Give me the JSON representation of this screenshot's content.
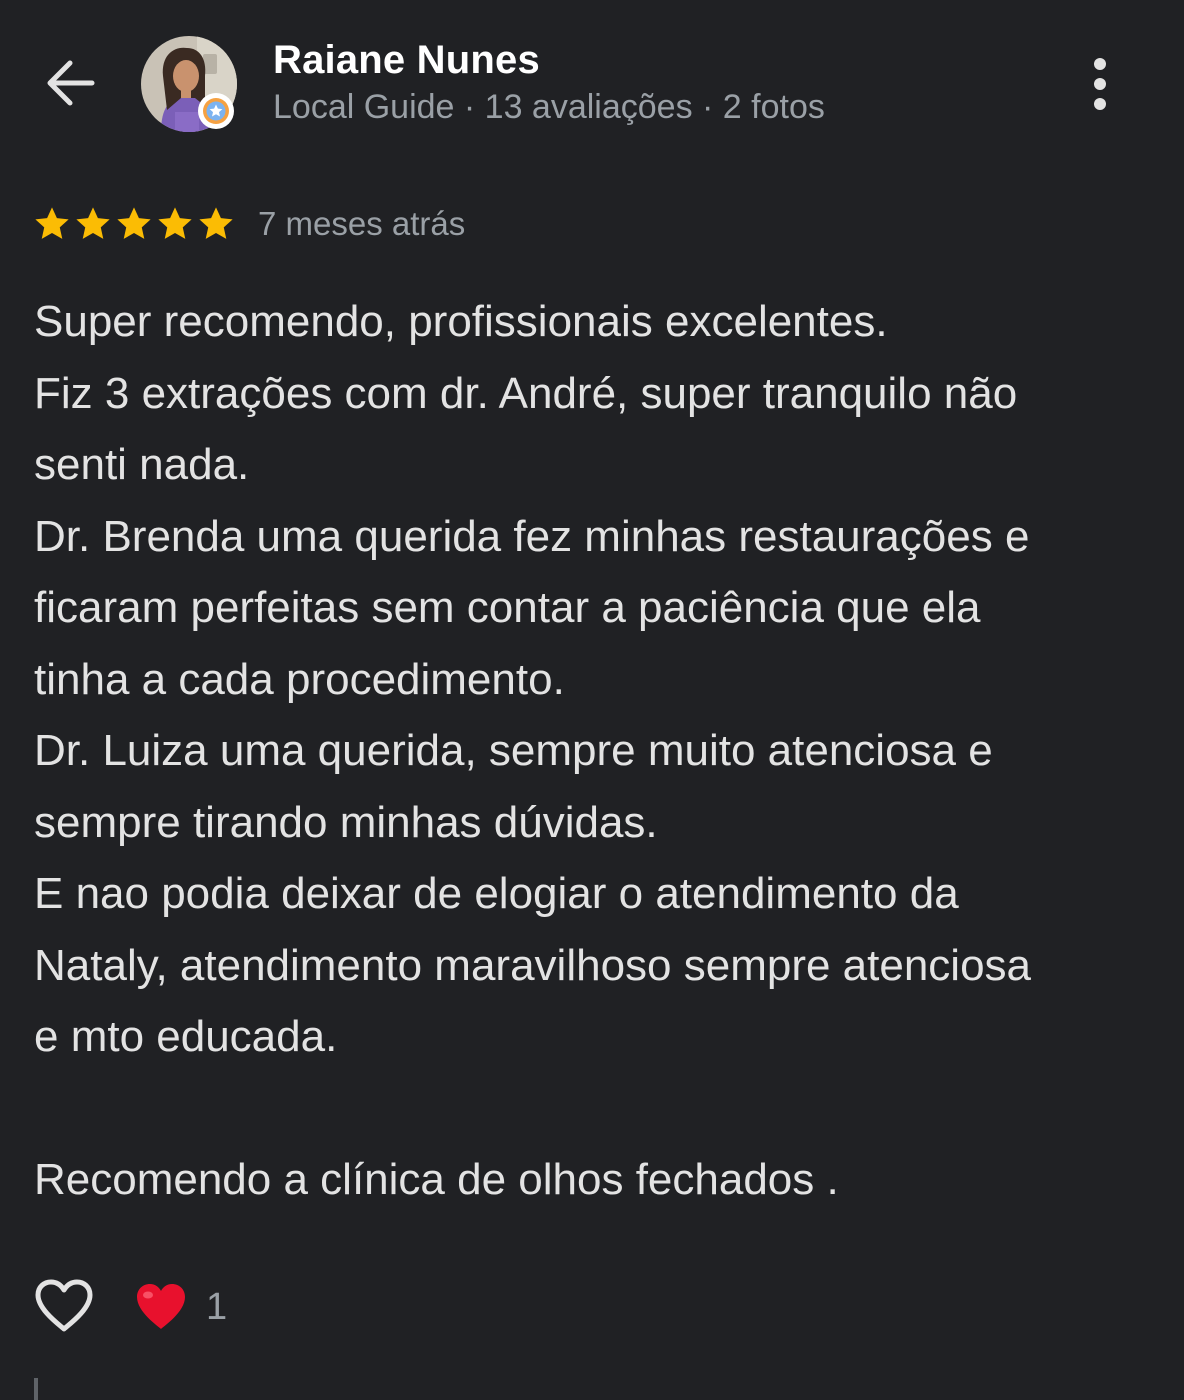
{
  "header": {
    "back_icon": "arrow-back-icon",
    "author_name": "Raiane Nunes",
    "author_meta": "Local Guide · 13 avaliações · 2 fotos",
    "avatar_badge_icon": "local-guide-star-badge-icon",
    "more_icon": "more-vertical-icon"
  },
  "review": {
    "rating": 5,
    "rating_max": 5,
    "time_ago": "7 meses atrás",
    "lines": [
      "Super recomendo, profissionais excelentes.",
      "Fiz 3 extrações com dr. André, super tranquilo não",
      "senti nada.",
      "Dr. Brenda uma querida fez minhas restaurações e",
      "ficaram perfeitas sem contar a paciência que ela",
      "tinha a cada procedimento.",
      "Dr. Luiza uma querida, sempre muito atenciosa e",
      "sempre tirando minhas dúvidas.",
      "E nao podia deixar de elogiar o atendimento da",
      "Nataly, atendimento maravilhoso sempre atenciosa",
      "e mto educada.",
      "",
      "Recomendo a clínica de olhos fechados ."
    ]
  },
  "actions": {
    "like_icon": "heart-outline-icon",
    "reaction_icon": "red-heart-emoji-icon",
    "reaction_count": "1"
  },
  "colors": {
    "background": "#202124",
    "star": "#fbbc04",
    "primary_text": "#e3e3e3",
    "secondary_text": "#9aa0a6",
    "reaction_heart": "#e8112d"
  }
}
